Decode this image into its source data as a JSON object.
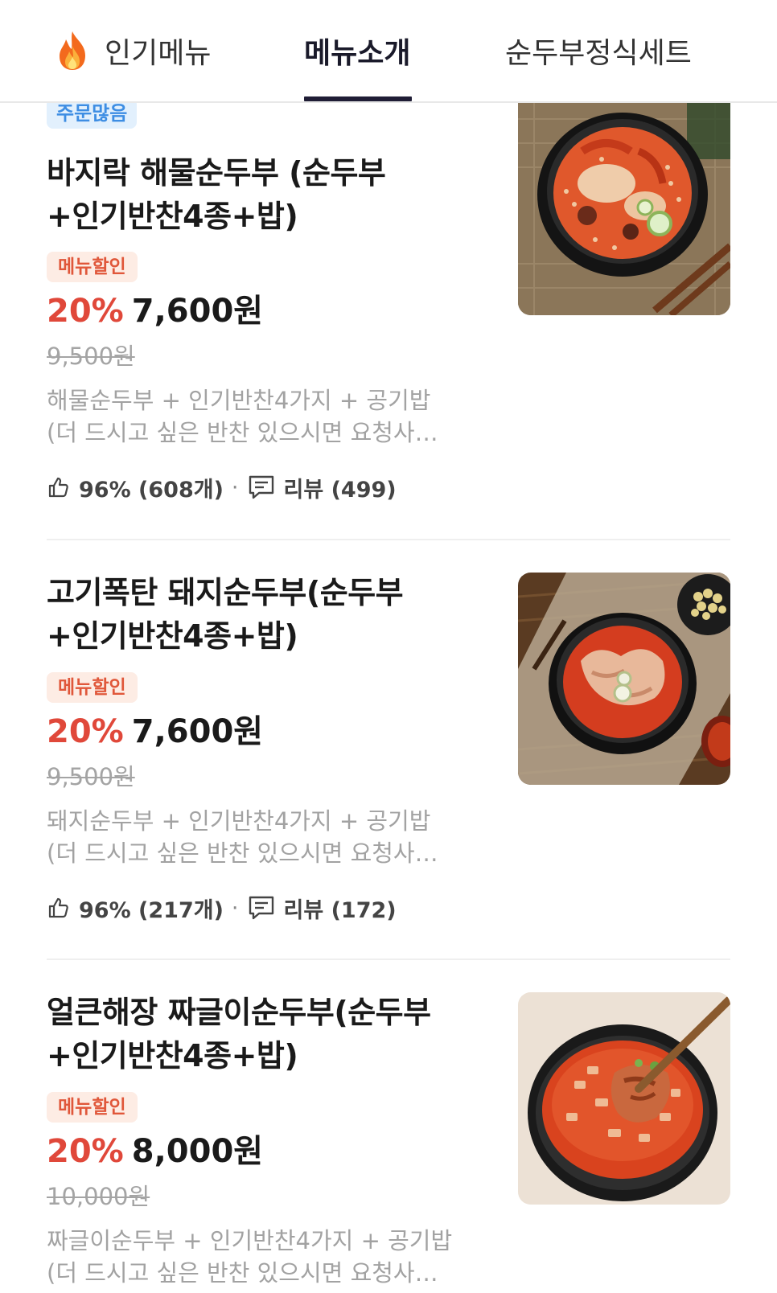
{
  "tabs": [
    {
      "label": "인기메뉴",
      "icon": "fire-icon"
    },
    {
      "label": "메뉴소개",
      "active": true
    },
    {
      "label": "순두부정식세트"
    }
  ],
  "items": [
    {
      "badge": "주문많음",
      "title_line1": "바지락 해물순두부 (순두부",
      "title_line2": "+인기반찬4종+밥)",
      "discount_badge": "메뉴할인",
      "discount_pct": "20%",
      "price": "7,600원",
      "original_price": "9,500원",
      "desc_line1": "해물순두부 + 인기반찬4가지 + 공기밥",
      "desc_line2": "(더 드시고 싶은 반찬 있으시면 요청사…",
      "likes": "96% (608개)",
      "dot": "·",
      "reviews": "리뷰 (499)",
      "image": "seafood-sundubu-photo"
    },
    {
      "title_line1": "고기폭탄 돼지순두부(순두부",
      "title_line2": "+인기반찬4종+밥)",
      "discount_badge": "메뉴할인",
      "discount_pct": "20%",
      "price": "7,600원",
      "original_price": "9,500원",
      "desc_line1": "돼지순두부 + 인기반찬4가지 + 공기밥",
      "desc_line2": "(더 드시고 싶은 반찬 있으시면 요청사…",
      "likes": "96% (217개)",
      "dot": "·",
      "reviews": "리뷰 (172)",
      "image": "pork-sundubu-photo"
    },
    {
      "title_line1": "얼큰해장  짜글이순두부(순두부",
      "title_line2": "+인기반찬4종+밥)",
      "discount_badge": "메뉴할인",
      "discount_pct": "20%",
      "price": "8,000원",
      "original_price": "10,000원",
      "desc_line1": "짜글이순두부 + 인기반찬4가지 + 공기밥",
      "desc_line2": "(더 드시고 싶은 반찬 있으시면 요청사…",
      "image": "jjageuli-sundubu-photo"
    }
  ],
  "colors": {
    "discount": "#e0483a",
    "badge_blue": "#3d8de3",
    "active_tab": "#1f1d35"
  }
}
